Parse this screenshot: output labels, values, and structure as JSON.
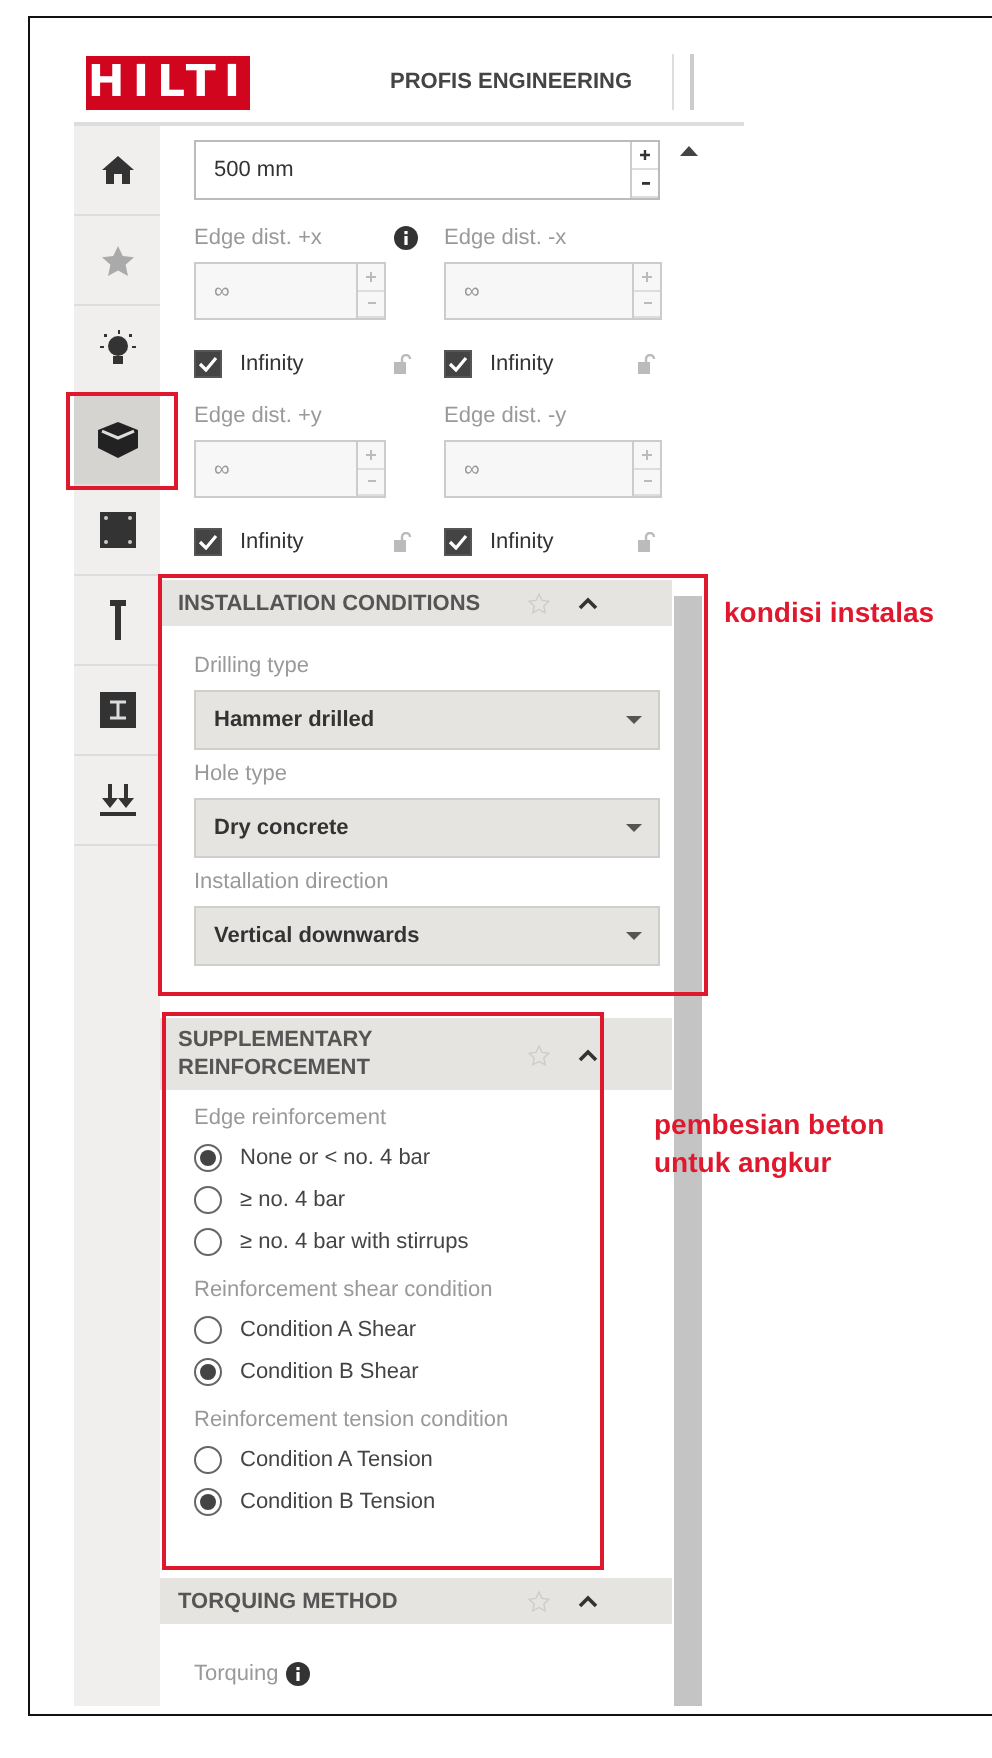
{
  "header": {
    "logo": "HILTI",
    "title": "PROFIS ENGINEERING"
  },
  "sidebar": {
    "items": [
      {
        "kind": "home",
        "selected": false,
        "highlighted": false
      },
      {
        "kind": "star",
        "selected": false,
        "highlighted": false
      },
      {
        "kind": "bulb",
        "selected": false,
        "highlighted": false
      },
      {
        "kind": "box",
        "selected": true,
        "highlighted": true
      },
      {
        "kind": "square",
        "selected": false,
        "highlighted": false
      },
      {
        "kind": "pin",
        "selected": false,
        "highlighted": false
      },
      {
        "kind": "beam",
        "selected": false,
        "highlighted": false
      },
      {
        "kind": "arrows",
        "selected": false,
        "highlighted": false
      }
    ]
  },
  "top_field": {
    "value": "500 mm"
  },
  "edge_distances": [
    {
      "label": "Edge dist. +x",
      "info": true,
      "placeholder": "∞",
      "disabled": true,
      "checkbox": "Infinity",
      "checked": true
    },
    {
      "label": "Edge dist. -x",
      "info": false,
      "placeholder": "∞",
      "disabled": true,
      "checkbox": "Infinity",
      "checked": true
    },
    {
      "label": "Edge dist. +y",
      "info": false,
      "placeholder": "∞",
      "disabled": true,
      "checkbox": "Infinity",
      "checked": true
    },
    {
      "label": "Edge dist. -y",
      "info": false,
      "placeholder": "∞",
      "disabled": true,
      "checkbox": "Infinity",
      "checked": true
    }
  ],
  "sections": [
    {
      "title": "INSTALLATION CONDITIONS",
      "kind": "dropdowns",
      "expanded": true,
      "highlighted": true,
      "annotation": "kondisi instalas",
      "fields": [
        {
          "label": "Drilling type",
          "value": "Hammer drilled"
        },
        {
          "label": "Hole type",
          "value": "Dry concrete"
        },
        {
          "label": "Installation direction",
          "value": "Vertical downwards"
        }
      ]
    },
    {
      "title": "SUPPLEMENTARY REINFORCEMENT",
      "kind": "radios",
      "expanded": true,
      "highlighted": true,
      "annotation": "pembesian beton untuk angkur",
      "groups": [
        {
          "label": "Edge reinforcement",
          "options": [
            {
              "label": "None or < no. 4 bar",
              "selected": true
            },
            {
              "label": "≥ no. 4 bar",
              "selected": false
            },
            {
              "label": "≥ no. 4 bar with stirrups",
              "selected": false
            }
          ]
        },
        {
          "label": "Reinforcement shear condition",
          "options": [
            {
              "label": "Condition A Shear",
              "selected": false
            },
            {
              "label": "Condition B Shear",
              "selected": true
            }
          ]
        },
        {
          "label": "Reinforcement tension condition",
          "options": [
            {
              "label": "Condition A Tension",
              "selected": false
            },
            {
              "label": "Condition B Tension",
              "selected": true
            }
          ]
        }
      ]
    },
    {
      "title": "TORQUING METHOD",
      "kind": "labels",
      "expanded": true,
      "highlighted": false,
      "fields": [
        {
          "label": "Torquing",
          "info": true
        }
      ]
    }
  ]
}
